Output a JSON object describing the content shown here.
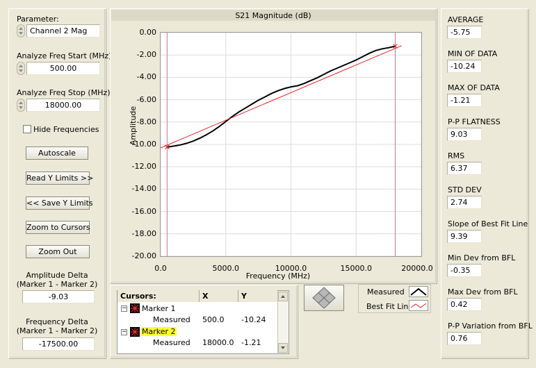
{
  "left": {
    "parameter": {
      "label": "Parameter:",
      "value": "Channel 2 Mag"
    },
    "freq_start": {
      "label": "Analyze Freq Start (MHz)",
      "value": "500.00"
    },
    "freq_stop": {
      "label": "Analyze Freq Stop (MHz)",
      "value": "18000.00"
    },
    "hide_frequencies": {
      "label": "Hide Frequencies",
      "checked": false
    },
    "buttons": {
      "autoscale": "Autoscale",
      "read_y_limits": "Read Y Limits >>",
      "save_y_limits": "<< Save Y Limits",
      "zoom_to_cursors": "Zoom to Cursors",
      "zoom_out": "Zoom Out"
    },
    "amplitude_delta": {
      "label_line1": "Amplitude Delta",
      "label_line2": "(Marker 1 - Marker 2)",
      "value": "-9.03"
    },
    "frequency_delta": {
      "label_line1": "Frequency Delta",
      "label_line2": "(Marker 1 - Marker 2)",
      "value": "-17500.00"
    }
  },
  "chart_data": {
    "type": "line",
    "title": "S21 Magnitude (dB)",
    "xlabel": "Frequency (MHz)",
    "ylabel": "Amplitude",
    "xlim": [
      0,
      20000
    ],
    "ylim": [
      -20,
      0
    ],
    "x_ticks": [
      "0.0",
      "5000.0",
      "10000.0",
      "15000.0",
      "20000.0"
    ],
    "y_ticks": [
      "0.00",
      "-2.00",
      "-4.00",
      "-6.00",
      "-8.00",
      "-10.00",
      "-12.00",
      "-14.00",
      "-16.00",
      "-18.00",
      "-20.00"
    ],
    "grid": true,
    "cursors_x": [
      500,
      18000
    ],
    "series": [
      {
        "name": "Measured",
        "color": "#000000",
        "x": [
          500,
          1000,
          1500,
          2000,
          2500,
          3000,
          3500,
          4000,
          4500,
          5000,
          5500,
          6000,
          6500,
          7000,
          7500,
          8000,
          8500,
          9000,
          9500,
          10000,
          10500,
          11000,
          11500,
          12000,
          12500,
          13000,
          13500,
          14000,
          14500,
          15000,
          15500,
          16000,
          16500,
          17000,
          17500,
          18000
        ],
        "y": [
          -10.24,
          -10.15,
          -10.05,
          -9.9,
          -9.7,
          -9.45,
          -9.15,
          -8.8,
          -8.4,
          -7.95,
          -7.5,
          -7.1,
          -6.75,
          -6.4,
          -6.05,
          -5.75,
          -5.45,
          -5.2,
          -5.0,
          -4.85,
          -4.75,
          -4.55,
          -4.3,
          -4.05,
          -3.75,
          -3.45,
          -3.2,
          -2.95,
          -2.7,
          -2.45,
          -2.15,
          -1.85,
          -1.6,
          -1.45,
          -1.35,
          -1.21
        ]
      },
      {
        "name": "Best Fit Line",
        "color": "#e02020",
        "x": [
          0,
          18500
        ],
        "y": [
          -10.31,
          -1.16
        ]
      }
    ]
  },
  "legend": [
    {
      "name": "Measured",
      "color": "#000000"
    },
    {
      "name": "Best Fit Line",
      "color": "#e02020"
    }
  ],
  "cursors": {
    "header": {
      "name": "Cursors:",
      "x": "X",
      "y": "Y"
    },
    "markers": [
      {
        "name": "Marker 1",
        "sub": "Measured",
        "x": "500.0",
        "y": "-10.24",
        "highlight": false
      },
      {
        "name": "Marker 2",
        "sub": "Measured",
        "x": "18000.0",
        "y": "-1.21",
        "highlight": true
      }
    ]
  },
  "stats": [
    {
      "label": "AVERAGE",
      "value": "-5.75"
    },
    {
      "label": "MIN OF DATA",
      "value": "-10.24"
    },
    {
      "label": "MAX OF DATA",
      "value": "-1.21"
    },
    {
      "label": "P-P FLATNESS",
      "value": "9.03"
    },
    {
      "label": "RMS",
      "value": "6.37"
    },
    {
      "label": "STD DEV",
      "value": "2.74"
    },
    {
      "label": "Slope of Best Fit Line",
      "value": "9.39"
    },
    {
      "label": "Min Dev from BFL",
      "value": "-0.35"
    },
    {
      "label": "Max Dev from BFL",
      "value": "0.42"
    },
    {
      "label": "P-P Variation from BFL",
      "value": "0.76"
    }
  ]
}
